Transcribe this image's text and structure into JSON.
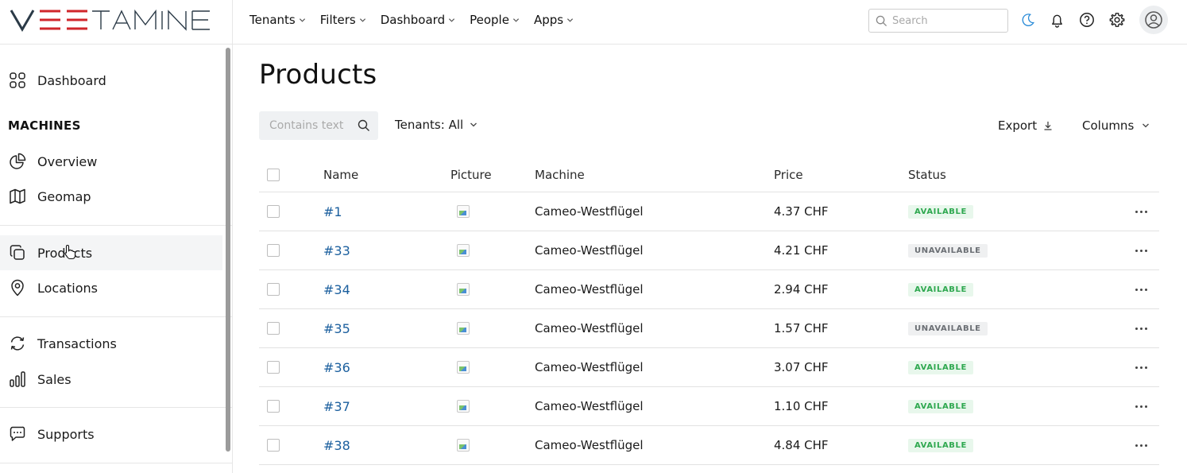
{
  "app": {
    "logo_text": "VEETAMINE"
  },
  "topnav": {
    "items": [
      {
        "label": "Tenants"
      },
      {
        "label": "Filters"
      },
      {
        "label": "Dashboard"
      },
      {
        "label": "People"
      },
      {
        "label": "Apps"
      }
    ],
    "search_placeholder": "Search"
  },
  "sidebar": {
    "dashboard": "Dashboard",
    "section_machines": "MACHINES",
    "overview": "Overview",
    "geomap": "Geomap",
    "products": "Products",
    "locations": "Locations",
    "transactions": "Transactions",
    "sales": "Sales",
    "supports": "Supports"
  },
  "main": {
    "title": "Products",
    "filter_placeholder": "Contains text",
    "tenants_filter": "Tenants: All",
    "export_label": "Export",
    "columns_label": "Columns"
  },
  "table": {
    "headers": {
      "name": "Name",
      "picture": "Picture",
      "machine": "Machine",
      "price": "Price",
      "status": "Status"
    },
    "rows": [
      {
        "name": "#1",
        "machine": "Cameo-Westflügel",
        "price": "4.37 CHF",
        "status": "AVAILABLE"
      },
      {
        "name": "#33",
        "machine": "Cameo-Westflügel",
        "price": "4.21 CHF",
        "status": "UNAVAILABLE"
      },
      {
        "name": "#34",
        "machine": "Cameo-Westflügel",
        "price": "2.94 CHF",
        "status": "AVAILABLE"
      },
      {
        "name": "#35",
        "machine": "Cameo-Westflügel",
        "price": "1.57 CHF",
        "status": "UNAVAILABLE"
      },
      {
        "name": "#36",
        "machine": "Cameo-Westflügel",
        "price": "3.07 CHF",
        "status": "AVAILABLE"
      },
      {
        "name": "#37",
        "machine": "Cameo-Westflügel",
        "price": "1.10 CHF",
        "status": "AVAILABLE"
      },
      {
        "name": "#38",
        "machine": "Cameo-Westflügel",
        "price": "4.84 CHF",
        "status": "AVAILABLE"
      }
    ]
  },
  "colors": {
    "logo_red": "#d0262b",
    "logo_dark": "#2b3a47",
    "link_blue": "#1b5f9e",
    "available_green": "#2ea84f",
    "moon_blue": "#2a8bd8"
  }
}
